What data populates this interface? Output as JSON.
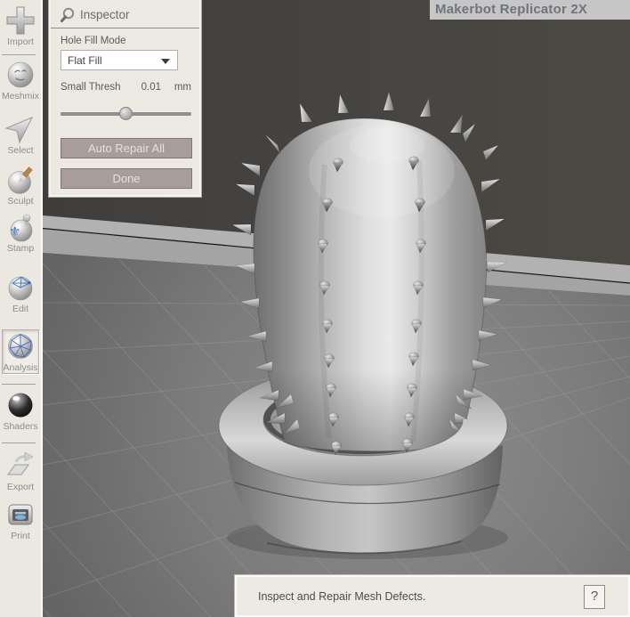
{
  "viewport": {
    "printer_label": "Makerbot Replicator 2X"
  },
  "sidebar": {
    "items": [
      {
        "label": "Import",
        "icon": "import-plus-icon",
        "selected": false
      },
      {
        "label": "Meshmix",
        "icon": "meshmix-sphere-icon",
        "selected": false
      },
      {
        "label": "Select",
        "icon": "select-arrow-icon",
        "selected": false
      },
      {
        "label": "Sculpt",
        "icon": "sculpt-brush-icon",
        "selected": false
      },
      {
        "label": "Stamp",
        "icon": "stamp-icon",
        "selected": false
      },
      {
        "label": "Edit",
        "icon": "edit-wireframe-icon",
        "selected": false
      },
      {
        "label": "Analysis",
        "icon": "analysis-mesh-icon",
        "selected": true
      },
      {
        "label": "Shaders",
        "icon": "shaders-sphere-icon",
        "selected": false
      },
      {
        "label": "Export",
        "icon": "export-arrow-icon",
        "selected": false
      },
      {
        "label": "Print",
        "icon": "print-icon",
        "selected": false
      }
    ]
  },
  "inspector": {
    "title": "Inspector",
    "hole_fill": {
      "label": "Hole Fill Mode",
      "value": "Flat Fill"
    },
    "small_thresh": {
      "label": "Small Thresh",
      "value": "0.01",
      "unit": "mm"
    },
    "buttons": {
      "auto_repair": "Auto Repair All",
      "done": "Done"
    }
  },
  "status_bar": {
    "message": "Inspect and Repair Mesh Defects.",
    "help": "?"
  },
  "colors": {
    "panel_bg": "#ece9e3",
    "button_bg": "#a89d99",
    "viewport_bg": "#454240",
    "platform_top": "#7a7a7a",
    "platform_edge": "#b2b2b2",
    "model_grey": "#c9c9c9",
    "printer_label_bg": "#c6c6c6",
    "accent_blue": "#4d7dc2"
  }
}
